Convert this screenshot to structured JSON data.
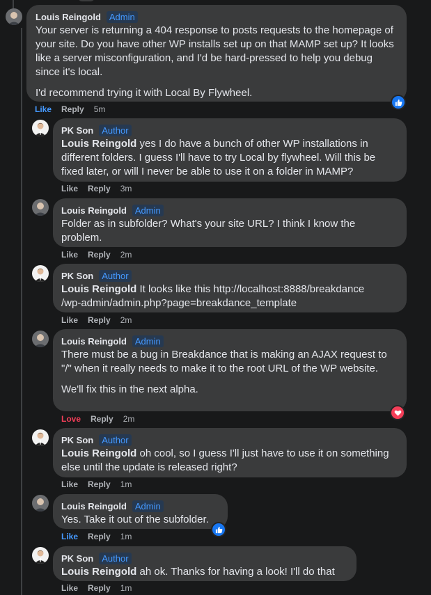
{
  "comments": [
    {
      "author": "Louis Reingold",
      "badge": "Admin",
      "paragraphs": [
        "Your server is returning a 404 response to posts requests to the homepage of your site. Do you have other WP installs set up on that MAMP set up? It looks like a server misconfiguration, and I'd be hard-pressed to help you debug since it's local.",
        "I'd recommend trying it with Local By Flywheel."
      ],
      "action": "Like",
      "reply": "Reply",
      "time": "5m",
      "reaction": "like"
    },
    {
      "author": "PK Son",
      "badge": "Author",
      "mention": "Louis Reingold",
      "text": " yes I do have a bunch of other WP installations in different folders. I guess I'll have to try Local by flywheel. Will this be fixed later, or will I never be able to use it on a folder in MAMP?",
      "action": "Like",
      "reply": "Reply",
      "time": "3m"
    },
    {
      "author": "Louis Reingold",
      "badge": "Admin",
      "text": "Folder as in subfolder? What's your site URL? I think I know the problem.",
      "action": "Like",
      "reply": "Reply",
      "time": "2m"
    },
    {
      "author": "PK Son",
      "badge": "Author",
      "mention": "Louis Reingold",
      "line1": " It looks like this http://localhost:8888/breakdance",
      "line2": "/wp-admin/admin.php?page=breakdance_template",
      "action": "Like",
      "reply": "Reply",
      "time": "2m"
    },
    {
      "author": "Louis Reingold",
      "badge": "Admin",
      "paragraphs": [
        "There must be a bug in Breakdance that is making an AJAX request to \"/\" when it really needs to make it to the root URL of the WP website.",
        "We'll fix this in the next alpha."
      ],
      "action": "Love",
      "reply": "Reply",
      "time": "2m",
      "reaction": "love"
    },
    {
      "author": "PK Son",
      "badge": "Author",
      "mention": "Louis Reingold",
      "text": " oh cool, so I guess I'll just have to use it on something else until the update is released right?",
      "action": "Like",
      "reply": "Reply",
      "time": "1m"
    },
    {
      "author": "Louis Reingold",
      "badge": "Admin",
      "text": "Yes. Take it out of the subfolder.",
      "action": "Like",
      "reply": "Reply",
      "time": "1m",
      "reaction": "like"
    },
    {
      "author": "PK Son",
      "badge": "Author",
      "mention": "Louis Reingold",
      "text": " ah ok. Thanks for having a look! I'll do that",
      "action": "Like",
      "reply": "Reply",
      "time": "1m"
    }
  ],
  "colors": {
    "background": "#18191a",
    "bubble": "#3a3b3c",
    "badge": "#4599ff",
    "like": "#1877f2",
    "love": "#f33e58"
  },
  "icons": {
    "like": "thumbs-up-icon",
    "love": "heart-icon"
  }
}
